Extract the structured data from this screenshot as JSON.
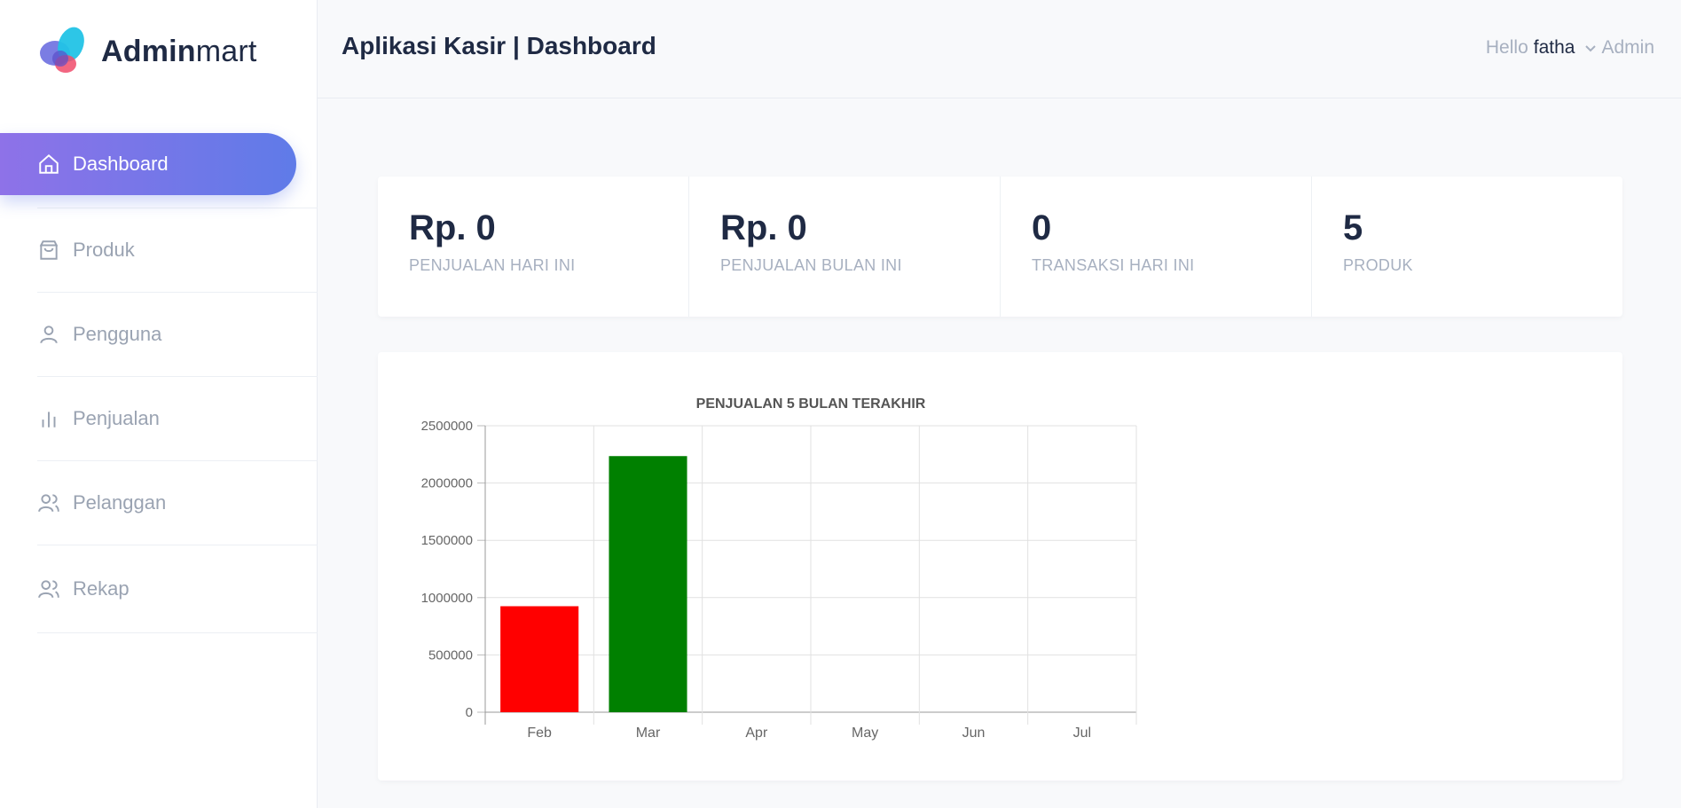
{
  "brand": {
    "bold": "Admin",
    "light": "mart"
  },
  "sidebar": {
    "items": [
      {
        "label": "Dashboard",
        "icon": "home-icon",
        "active": true
      },
      {
        "label": "Produk",
        "icon": "shopping-bag-icon",
        "active": false
      },
      {
        "label": "Pengguna",
        "icon": "user-icon",
        "active": false
      },
      {
        "label": "Penjualan",
        "icon": "bar-chart-icon",
        "active": false
      },
      {
        "label": "Pelanggan",
        "icon": "users-icon",
        "active": false
      },
      {
        "label": "Rekap",
        "icon": "users-icon",
        "active": false
      }
    ]
  },
  "header": {
    "title": "Aplikasi Kasir | Dashboard",
    "greeting": "Hello",
    "user_name": "fatha",
    "role": "Admin"
  },
  "stats": [
    {
      "value": "Rp. 0",
      "label": "PENJUALAN HARI INI"
    },
    {
      "value": "Rp. 0",
      "label": "PENJUALAN BULAN INI"
    },
    {
      "value": "0",
      "label": "TRANSAKSI HARI INI"
    },
    {
      "value": "5",
      "label": "PRODUK"
    }
  ],
  "colors": {
    "accent_start": "#8e72e8",
    "accent_end": "#5f7be8",
    "bar_feb": "#ff0000",
    "bar_mar": "#008000"
  },
  "chart_data": {
    "type": "bar",
    "title": "PENJUALAN 5 BULAN TERAKHIR",
    "categories": [
      "Feb",
      "Mar",
      "Apr",
      "May",
      "Jun",
      "Jul"
    ],
    "values": [
      925000,
      2235000,
      0,
      0,
      0,
      0
    ],
    "colors": [
      "#ff0000",
      "#008000",
      "#ff0000",
      "#008000",
      "#ff0000",
      "#008000"
    ],
    "ylim": [
      0,
      2500000
    ],
    "yticks": [
      "0",
      "500000",
      "1000000",
      "1500000",
      "2000000",
      "2500000"
    ],
    "grid": true,
    "legend": "none"
  }
}
